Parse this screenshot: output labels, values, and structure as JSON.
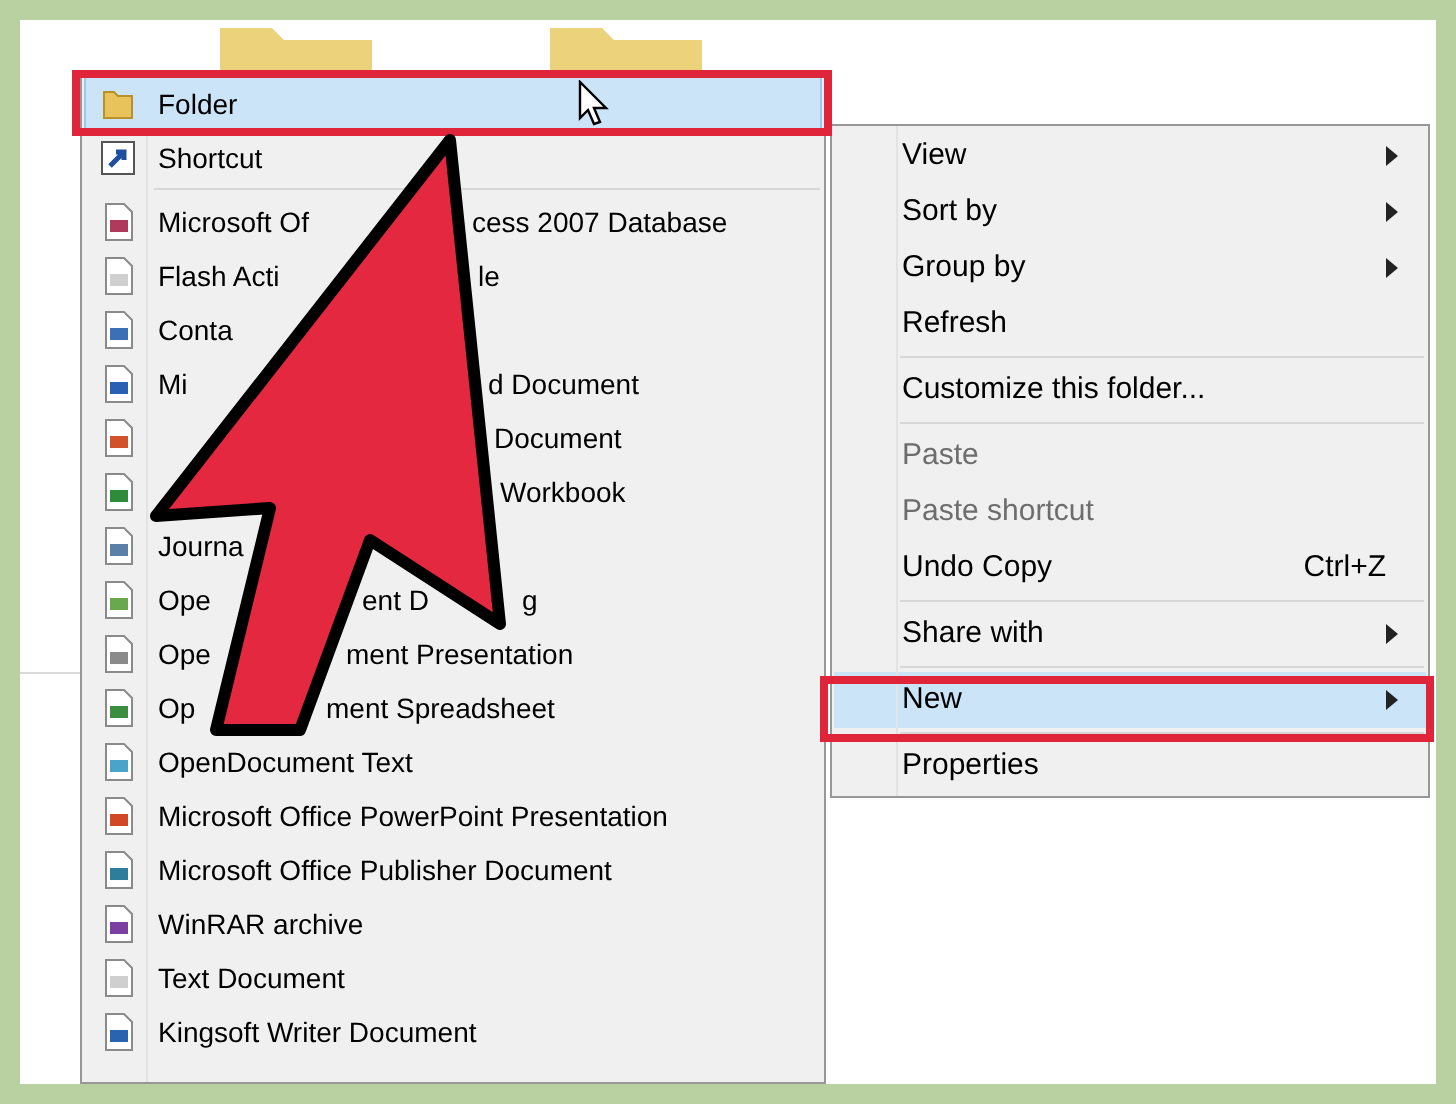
{
  "new_menu": {
    "items": [
      {
        "kind": "item",
        "parts": [
          "Folder"
        ],
        "selected": true
      },
      {
        "kind": "item",
        "parts": [
          "Shortcut"
        ],
        "selected": false
      },
      {
        "kind": "separator"
      },
      {
        "kind": "item",
        "parts": [
          "Microsoft Of",
          "cess 2007 Database"
        ],
        "selected": false
      },
      {
        "kind": "item",
        "parts": [
          "Flash Acti",
          "le"
        ],
        "selected": false
      },
      {
        "kind": "item",
        "parts": [
          "Conta"
        ],
        "selected": false
      },
      {
        "kind": "item",
        "parts": [
          "Mi",
          "d Document"
        ],
        "selected": false
      },
      {
        "kind": "item",
        "parts": [
          "Document"
        ],
        "selected": false
      },
      {
        "kind": "item",
        "parts": [
          "Workbook"
        ],
        "selected": false
      },
      {
        "kind": "item",
        "parts": [
          "Journa"
        ],
        "selected": false
      },
      {
        "kind": "item",
        "parts": [
          "Ope",
          "ent D",
          "g"
        ],
        "selected": false
      },
      {
        "kind": "item",
        "parts": [
          "Ope",
          "ment Presentation"
        ],
        "selected": false
      },
      {
        "kind": "item",
        "parts": [
          "Op",
          "ment Spreadsheet"
        ],
        "selected": false
      },
      {
        "kind": "item",
        "parts": [
          "OpenDocument Text"
        ],
        "selected": false
      },
      {
        "kind": "item",
        "parts": [
          "Microsoft Office PowerPoint Presentation"
        ],
        "selected": false
      },
      {
        "kind": "item",
        "parts": [
          "Microsoft Office Publisher Document"
        ],
        "selected": false
      },
      {
        "kind": "item",
        "parts": [
          "WinRAR archive"
        ],
        "selected": false
      },
      {
        "kind": "item",
        "parts": [
          "Text Document"
        ],
        "selected": false
      },
      {
        "kind": "item",
        "parts": [
          "Kingsoft Writer Document"
        ],
        "selected": false
      }
    ]
  },
  "context_menu": {
    "items": [
      {
        "kind": "item",
        "label": "View",
        "submenu": true,
        "disabled": false,
        "selected": false
      },
      {
        "kind": "item",
        "label": "Sort by",
        "submenu": true,
        "disabled": false,
        "selected": false
      },
      {
        "kind": "item",
        "label": "Group by",
        "submenu": true,
        "disabled": false,
        "selected": false
      },
      {
        "kind": "item",
        "label": "Refresh",
        "submenu": false,
        "disabled": false,
        "selected": false
      },
      {
        "kind": "separator"
      },
      {
        "kind": "item",
        "label": "Customize this folder...",
        "submenu": false,
        "disabled": false,
        "selected": false
      },
      {
        "kind": "separator"
      },
      {
        "kind": "item",
        "label": "Paste",
        "submenu": false,
        "disabled": true,
        "selected": false
      },
      {
        "kind": "item",
        "label": "Paste shortcut",
        "submenu": false,
        "disabled": true,
        "selected": false
      },
      {
        "kind": "item",
        "label": "Undo Copy",
        "shortcut": "Ctrl+Z",
        "submenu": false,
        "disabled": false,
        "selected": false
      },
      {
        "kind": "separator"
      },
      {
        "kind": "item",
        "label": "Share with",
        "submenu": true,
        "disabled": false,
        "selected": false
      },
      {
        "kind": "separator"
      },
      {
        "kind": "item",
        "label": "New",
        "submenu": true,
        "disabled": false,
        "selected": true
      },
      {
        "kind": "separator"
      },
      {
        "kind": "item",
        "label": "Properties",
        "submenu": false,
        "disabled": false,
        "selected": false
      }
    ]
  }
}
